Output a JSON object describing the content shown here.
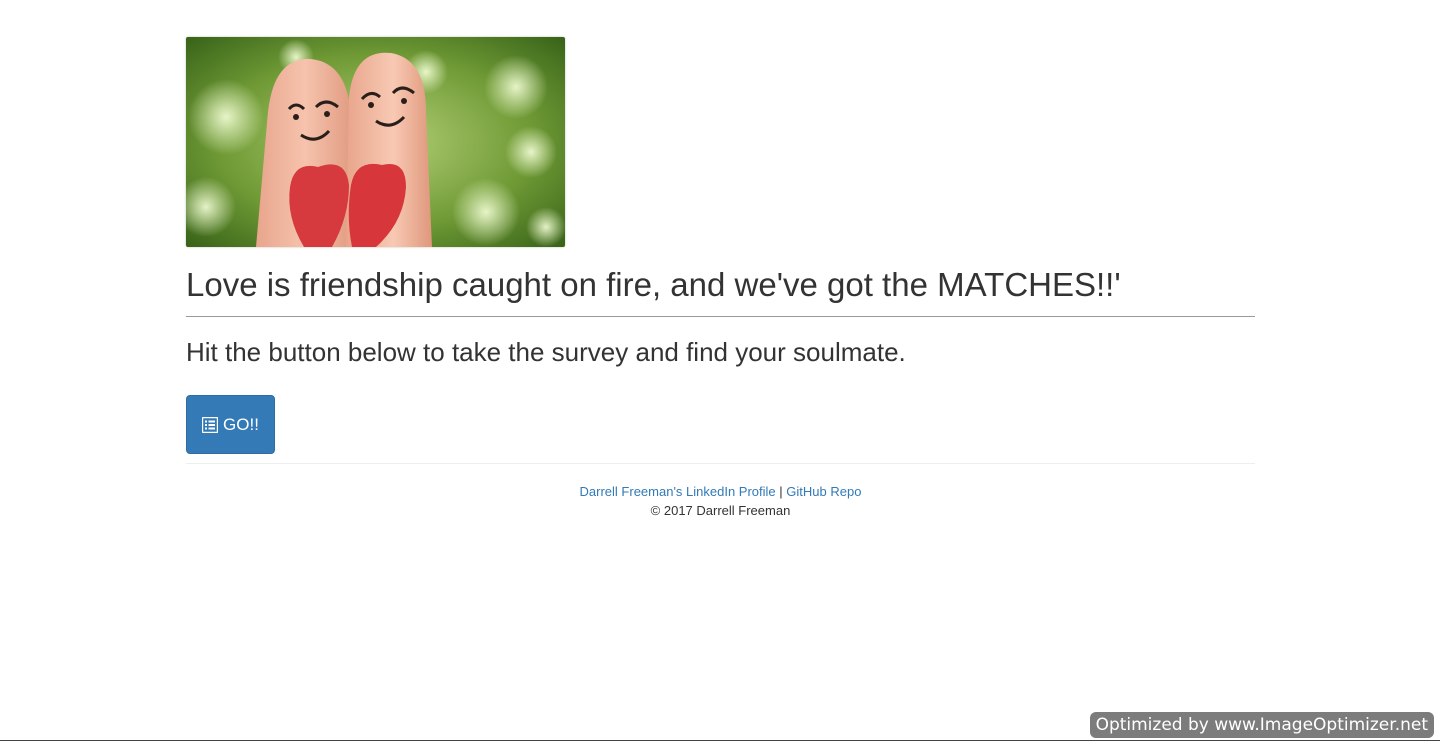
{
  "hero": {
    "image_icon": "couple-fingers-photo"
  },
  "headline": "Love is friendship caught on fire, and we've got the MATCHES!!'",
  "subline": "Hit the button below to take the survey and find your soulmate.",
  "go_button": {
    "label": "GO!!",
    "icon": "list-alt-icon",
    "color": "#337ab7"
  },
  "footer": {
    "linkedin_label": "Darrell Freeman's LinkedIn Profile",
    "separator": "|",
    "github_label": "GitHub Repo",
    "copyright": "© 2017 Darrell Freeman",
    "link_color": "#337ab7"
  },
  "watermark": "Optimized by www.ImageOptimizer.net"
}
